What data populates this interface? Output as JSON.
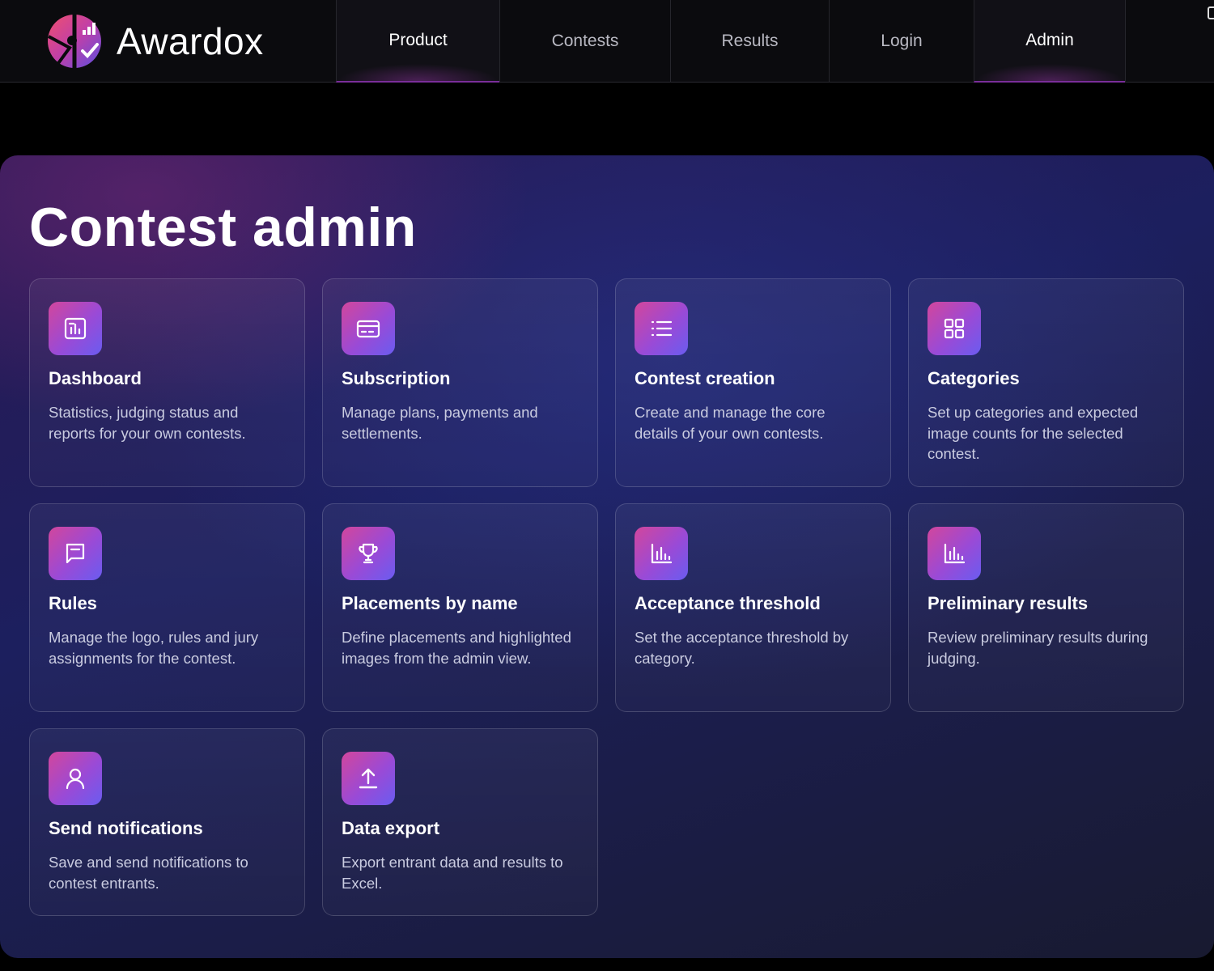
{
  "brand": {
    "name": "Awardox"
  },
  "nav": {
    "items": [
      {
        "label": "Product",
        "active": true
      },
      {
        "label": "Contests",
        "active": false
      },
      {
        "label": "Results",
        "active": false
      },
      {
        "label": "Login",
        "active": false
      },
      {
        "label": "Admin",
        "active": true
      }
    ]
  },
  "page": {
    "title": "Contest admin"
  },
  "cards": [
    {
      "icon": "dashboard-icon",
      "title": "Dashboard",
      "description": "Statistics, judging status and reports for your own contests."
    },
    {
      "icon": "card-icon",
      "title": "Subscription",
      "description": "Manage plans, payments and settlements."
    },
    {
      "icon": "list-icon",
      "title": "Contest creation",
      "description": "Create and manage the core details of your own contests."
    },
    {
      "icon": "grid-icon",
      "title": "Categories",
      "description": "Set up categories and expected image counts for the selected contest."
    },
    {
      "icon": "rules-icon",
      "title": "Rules",
      "description": "Manage the logo, rules and jury assignments for the contest."
    },
    {
      "icon": "trophy-icon",
      "title": "Placements by name",
      "description": "Define placements and highlighted images from the admin view."
    },
    {
      "icon": "bar-chart-icon",
      "title": "Acceptance threshold",
      "description": "Set the acceptance threshold by category."
    },
    {
      "icon": "bar-chart-icon",
      "title": "Preliminary results",
      "description": "Review preliminary results during judging."
    },
    {
      "icon": "user-icon",
      "title": "Send notifications",
      "description": "Save and send notifications to contest entrants."
    },
    {
      "icon": "upload-icon",
      "title": "Data export",
      "description": "Export entrant data and results to Excel."
    }
  ],
  "colors": {
    "accent_pink": "#d2469c",
    "accent_purple": "#9a4ad6",
    "accent_blue": "#6a5cf0",
    "nav_bg": "#0b0b0e",
    "panel_bg": "#1c1f5e"
  }
}
